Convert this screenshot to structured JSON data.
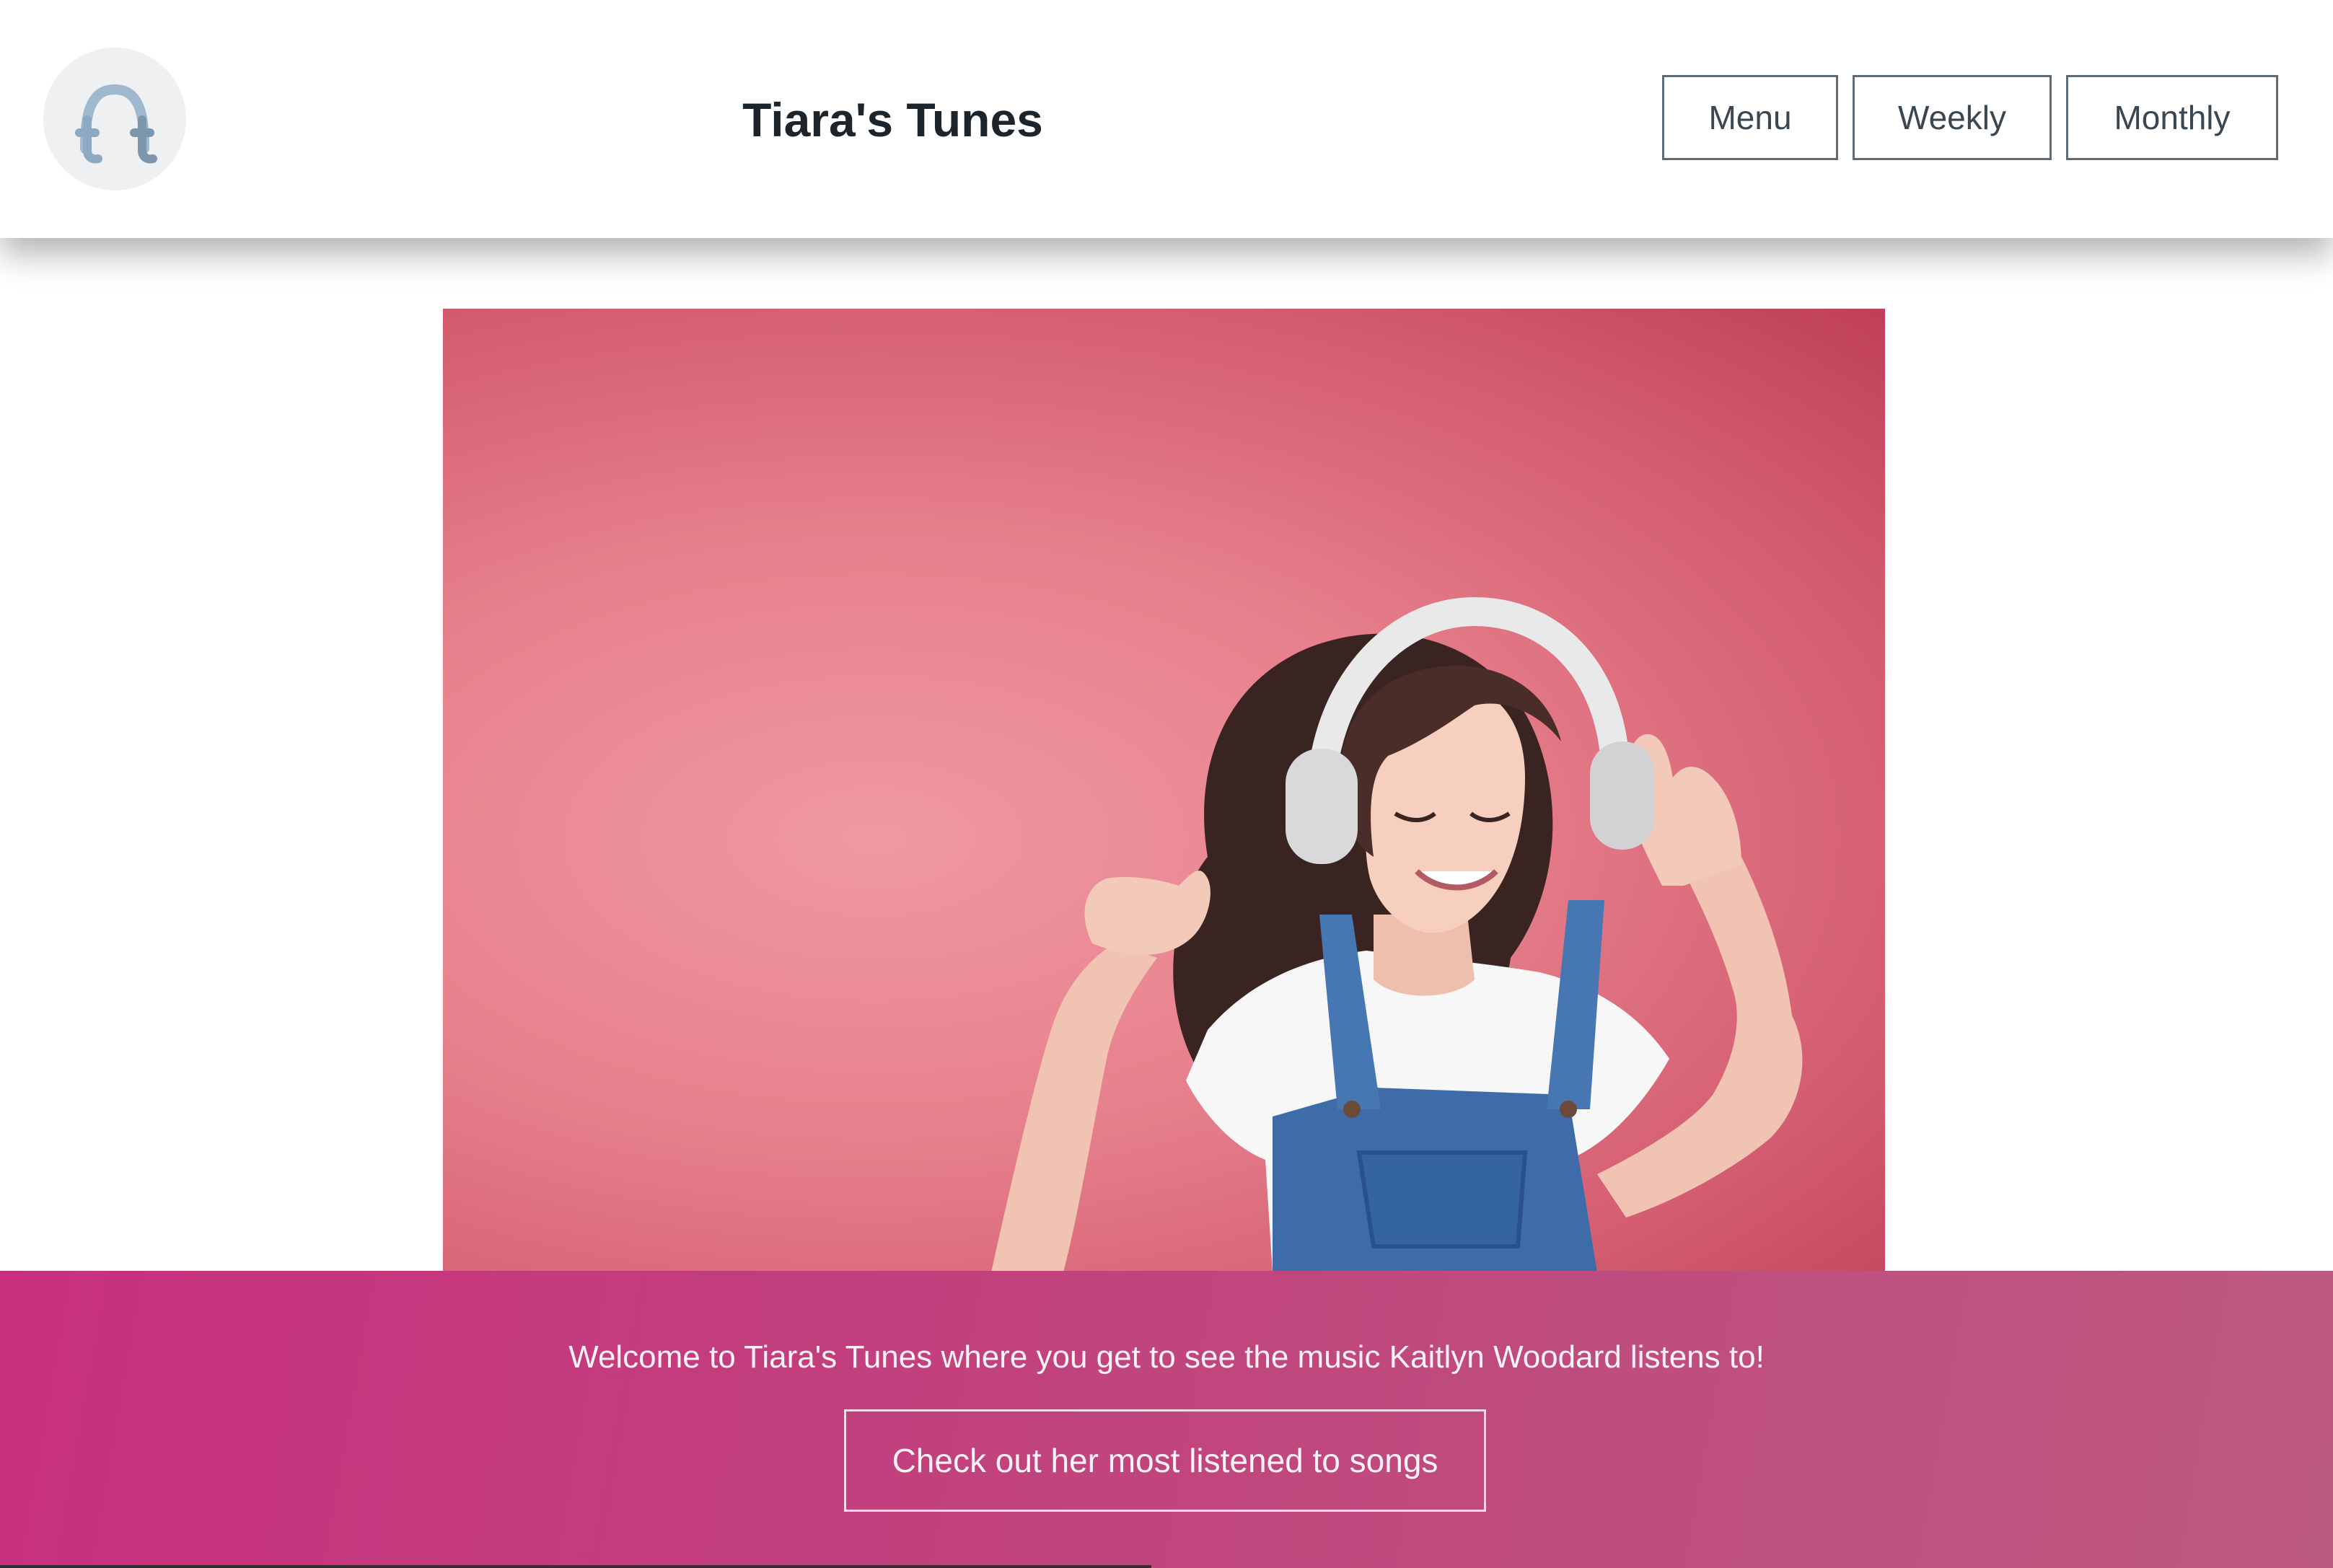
{
  "header": {
    "title": "Tiara's Tunes",
    "logo_icon": "headphones-t-icon",
    "nav": {
      "menu_label": "Menu",
      "weekly_label": "Weekly",
      "monthly_label": "Monthly"
    }
  },
  "hero": {
    "image": "woman-with-headphones-dancing-photo",
    "background_color": "#e7808c"
  },
  "banner": {
    "welcome_text": "Welcome to Tiara's Tunes where you get to see the music Kaitlyn Woodard listens to!",
    "cta_label": "Check out her most listened to songs",
    "background_color": "#c8307e"
  }
}
